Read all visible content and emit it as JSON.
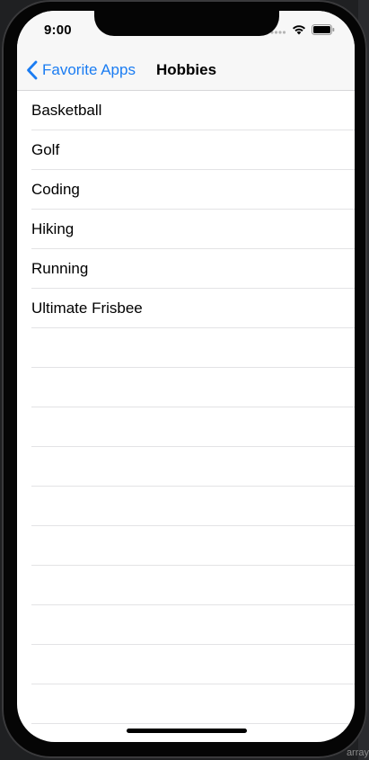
{
  "status_bar": {
    "time": "9:00",
    "icons": [
      "cellular-dots-icon",
      "wifi-icon",
      "battery-icon"
    ]
  },
  "nav_bar": {
    "back_label": "Favorite Apps",
    "back_icon": "chevron-left-icon",
    "title": "Hobbies",
    "accent_color": "#1a7cf2"
  },
  "list": {
    "items": [
      {
        "label": "Basketball"
      },
      {
        "label": "Golf"
      },
      {
        "label": "Coding"
      },
      {
        "label": "Hiking"
      },
      {
        "label": "Running"
      },
      {
        "label": "Ultimate Frisbee"
      }
    ]
  },
  "side_panel": {
    "text": "array"
  }
}
